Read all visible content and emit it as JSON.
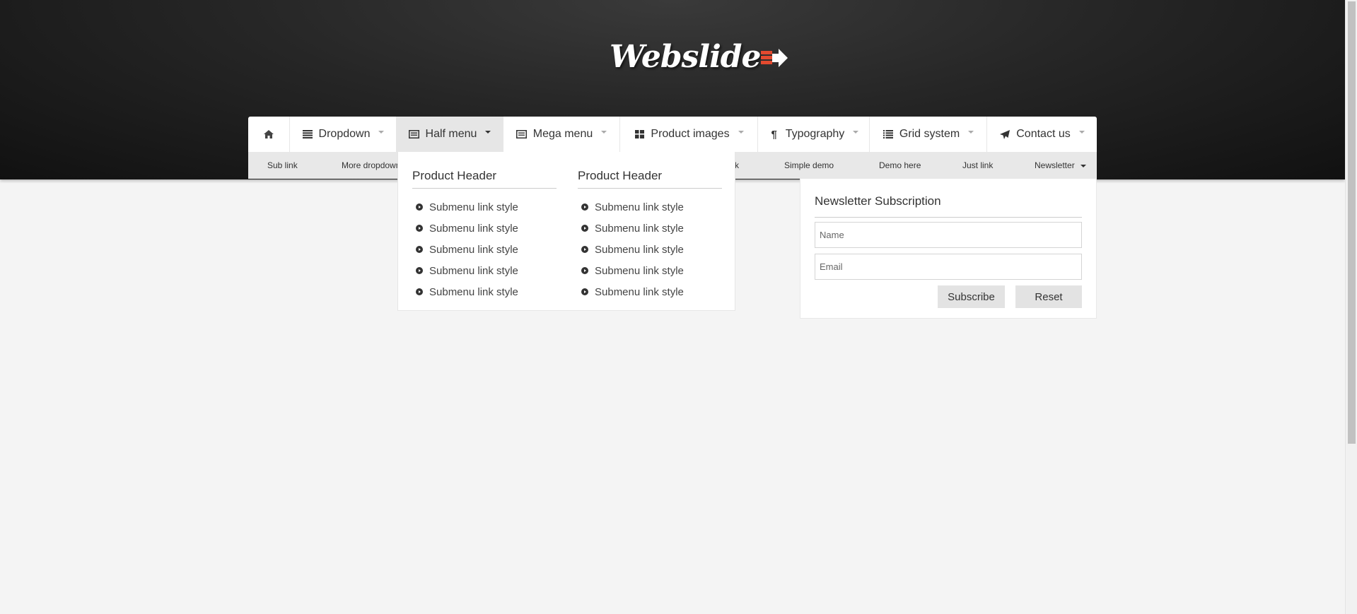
{
  "brand": {
    "logo_text": "Webslide"
  },
  "nav": {
    "items": [
      {
        "label": "",
        "icon": "home-icon"
      },
      {
        "label": "Dropdown",
        "icon": "list-icon"
      },
      {
        "label": "Half menu",
        "icon": "card-icon"
      },
      {
        "label": "Mega menu",
        "icon": "card-icon"
      },
      {
        "label": "Product images",
        "icon": "grid-icon"
      },
      {
        "label": "Typography",
        "icon": "paragraph-icon"
      },
      {
        "label": "Grid system",
        "icon": "list-bullets-icon"
      },
      {
        "label": "Contact us",
        "icon": "paper-plane-icon"
      }
    ],
    "active": "Half menu"
  },
  "subnav": {
    "items": [
      "Sub link",
      "More dropdown",
      "k",
      "Simple demo",
      "Demo here",
      "Just link",
      "Newsletter"
    ]
  },
  "half_menu": {
    "columns": [
      {
        "header": "Product Header",
        "links": [
          "Submenu link style",
          "Submenu link style",
          "Submenu link style",
          "Submenu link style",
          "Submenu link style"
        ]
      },
      {
        "header": "Product Header",
        "links": [
          "Submenu link style",
          "Submenu link style",
          "Submenu link style",
          "Submenu link style",
          "Submenu link style"
        ]
      }
    ]
  },
  "newsletter": {
    "title": "Newsletter Subscription",
    "name_placeholder": "Name",
    "email_placeholder": "Email",
    "subscribe_label": "Subscribe",
    "reset_label": "Reset"
  },
  "colors": {
    "header_dark": "#1f1f1f",
    "accent_red": "#e34a2f",
    "active_tab": "#e6e6e6"
  }
}
